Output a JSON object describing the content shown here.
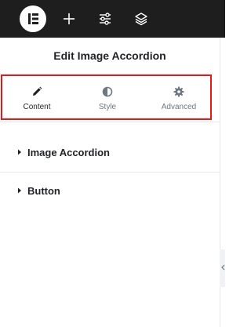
{
  "toolbar": {
    "logo_icon": "elementor-logo-icon",
    "add_icon": "plus-icon",
    "settings_icon": "sliders-icon",
    "navigator_icon": "layers-icon"
  },
  "panel": {
    "title": "Edit Image Accordion",
    "tabs": [
      {
        "label": "Content",
        "icon": "pencil-icon",
        "active": true
      },
      {
        "label": "Style",
        "icon": "half-circle-icon",
        "active": false
      },
      {
        "label": "Advanced",
        "icon": "gear-icon",
        "active": false
      }
    ],
    "sections": [
      {
        "label": "Image Accordion"
      },
      {
        "label": "Button"
      }
    ]
  },
  "colors": {
    "toolbar_bg": "#1e1e1e",
    "highlight_border": "#e11a1a",
    "text_dark": "#1f2124",
    "text_muted": "#6d7882"
  }
}
